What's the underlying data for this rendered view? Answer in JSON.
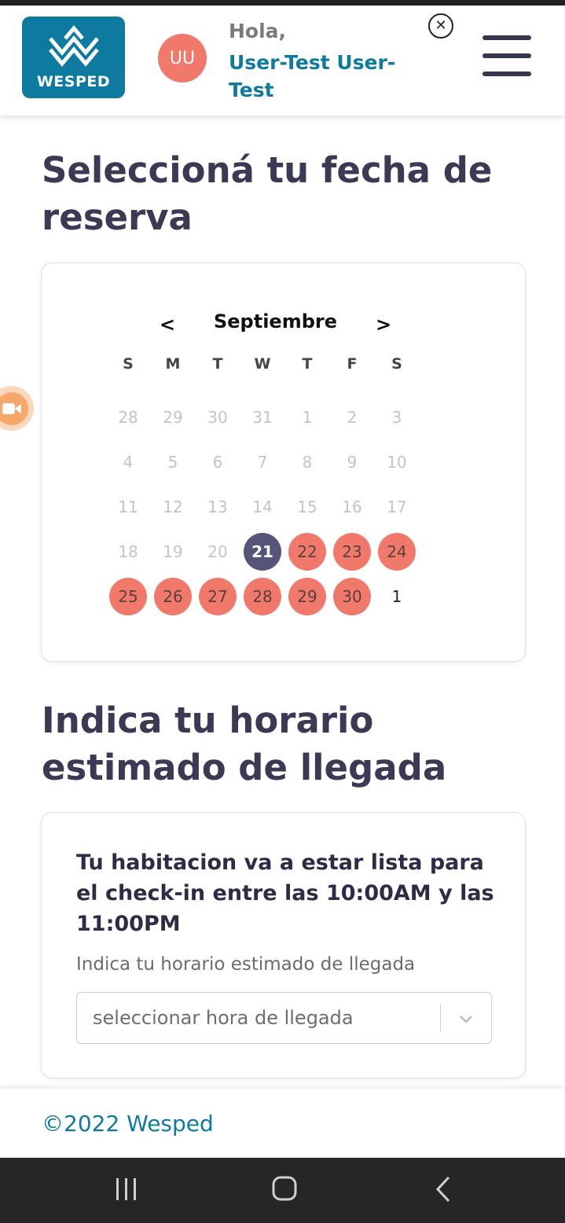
{
  "header": {
    "logo_text": "WESPED",
    "avatar_initials": "UU",
    "greeting": "Hola,",
    "user_name": "User-Test User-Test",
    "close_symbol": "✕"
  },
  "calendar_section": {
    "title": "Seleccioná tu fecha de reserva",
    "month": "Septiembre",
    "prev_label": "<",
    "next_label": ">",
    "weekdays": [
      "S",
      "M",
      "T",
      "W",
      "T",
      "F",
      "S"
    ],
    "weeks": [
      [
        {
          "d": "28",
          "s": "muted"
        },
        {
          "d": "29",
          "s": "muted"
        },
        {
          "d": "30",
          "s": "muted"
        },
        {
          "d": "31",
          "s": "muted"
        },
        {
          "d": "1",
          "s": "muted"
        },
        {
          "d": "2",
          "s": "muted"
        },
        {
          "d": "3",
          "s": "muted"
        }
      ],
      [
        {
          "d": "4",
          "s": "muted"
        },
        {
          "d": "5",
          "s": "muted"
        },
        {
          "d": "6",
          "s": "muted"
        },
        {
          "d": "7",
          "s": "muted"
        },
        {
          "d": "8",
          "s": "muted"
        },
        {
          "d": "9",
          "s": "muted"
        },
        {
          "d": "10",
          "s": "muted"
        }
      ],
      [
        {
          "d": "11",
          "s": "muted"
        },
        {
          "d": "12",
          "s": "muted"
        },
        {
          "d": "13",
          "s": "muted"
        },
        {
          "d": "14",
          "s": "muted"
        },
        {
          "d": "15",
          "s": "muted"
        },
        {
          "d": "16",
          "s": "muted"
        },
        {
          "d": "17",
          "s": "muted"
        }
      ],
      [
        {
          "d": "18",
          "s": "muted"
        },
        {
          "d": "19",
          "s": "muted"
        },
        {
          "d": "20",
          "s": "muted"
        },
        {
          "d": "21",
          "s": "selected"
        },
        {
          "d": "22",
          "s": "avail"
        },
        {
          "d": "23",
          "s": "avail"
        },
        {
          "d": "24",
          "s": "avail"
        }
      ],
      [
        {
          "d": "25",
          "s": "avail"
        },
        {
          "d": "26",
          "s": "avail"
        },
        {
          "d": "27",
          "s": "avail"
        },
        {
          "d": "28",
          "s": "avail"
        },
        {
          "d": "29",
          "s": "avail"
        },
        {
          "d": "30",
          "s": "avail"
        },
        {
          "d": "1",
          "s": "next"
        }
      ]
    ]
  },
  "arrival_section": {
    "title": "Indica tu horario estimado de llegada",
    "info_text": "Tu habitacion va a estar lista para el check-in entre las 10:00AM y las 11:00PM",
    "field_label": "Indica tu horario estimado de llegada",
    "select_placeholder": "seleccionar hora de llegada"
  },
  "footer": {
    "copyright": "©2022 Wesped"
  },
  "colors": {
    "brand": "#0e7a9f",
    "available_day": "#f0796b",
    "selected_day": "#545578",
    "heading": "#3b3a55"
  },
  "icons": {
    "close": "close-icon",
    "menu": "menu-icon",
    "video": "video-camera-icon",
    "chevron": "chevron-down-icon",
    "nav_recents": "recents-icon",
    "nav_home": "home-icon",
    "nav_back": "back-icon"
  }
}
